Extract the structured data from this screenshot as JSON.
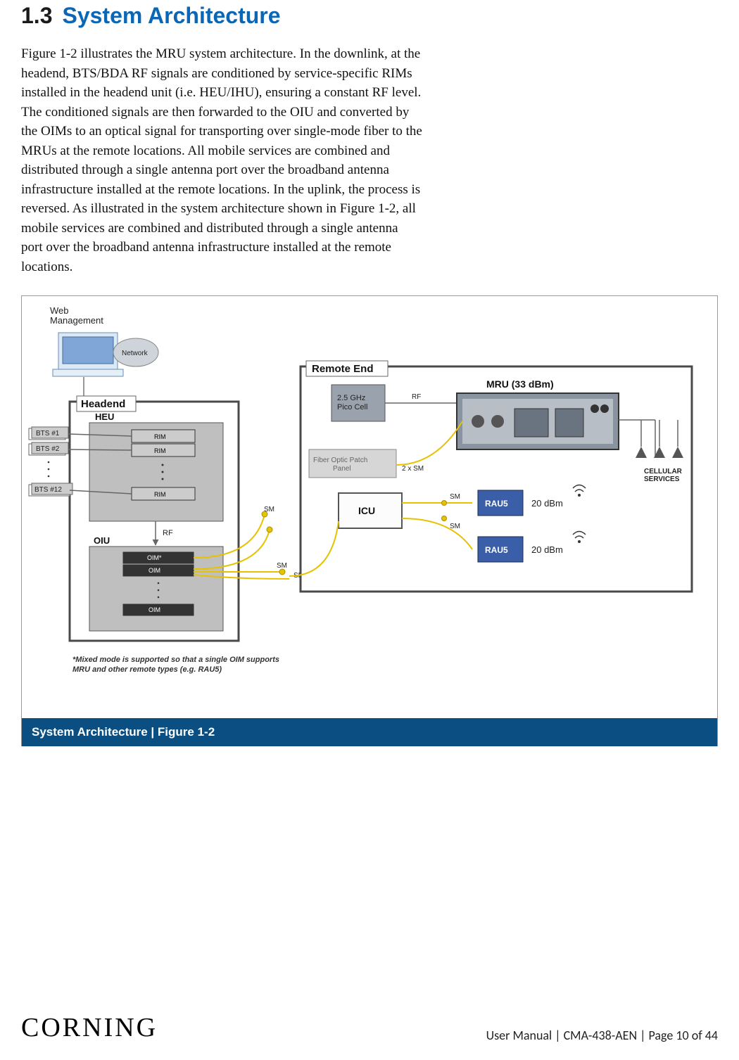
{
  "heading": {
    "num": "1.3",
    "title": "System Architecture"
  },
  "body_text": "Figure 1-2 illustrates the MRU system architecture. In the downlink, at the headend, BTS/BDA RF signals are conditioned by service-specific RIMs installed in the headend unit (i.e. HEU/IHU), ensuring a constant RF level. The conditioned signals are then forwarded to the OIU and converted by the OIMs to an optical signal for transporting over single-mode fiber to the MRUs at the remote locations. All mobile services are combined and distributed through a single antenna port over the broadband antenna infrastructure installed at the remote locations. In the uplink, the process is reversed. As illustrated in the system architecture shown in Figure 1-2, all mobile services are combined and distributed through a single antenna port over the broadband antenna infrastructure installed at the remote locations.",
  "caption": "System Architecture | Figure 1-2",
  "footer": {
    "brand": "CORNING",
    "page_info": "User Manual | CMA-438-AEN | Page 10 of 44"
  },
  "diagram": {
    "web_mgmt": "Web\nManagement",
    "network": "Network",
    "headend": "Headend",
    "heu": "HEU",
    "rim": "RIM",
    "bts1": "BTS #1",
    "bts2": "BTS #2",
    "bts12": "BTS #12",
    "oiu": "OIU",
    "oim": "OIM",
    "oim_star": "OIM*",
    "rf": "RF",
    "sm": "SM",
    "two_sm": "2 x SM",
    "remote_end": "Remote End",
    "pico": "2.5 GHz\nPico Cell",
    "fiber_panel": "Fiber Optic Patch\nPanel",
    "icu": "ICU",
    "mru": "MRU (33 dBm)",
    "rau5": "RAU5",
    "dbm20": "20 dBm",
    "cellular": "CELLULAR\nSERVICES",
    "note": "*Mixed mode is supported so that a single OIM supports\nMRU and other remote types (e.g. RAU5)"
  }
}
